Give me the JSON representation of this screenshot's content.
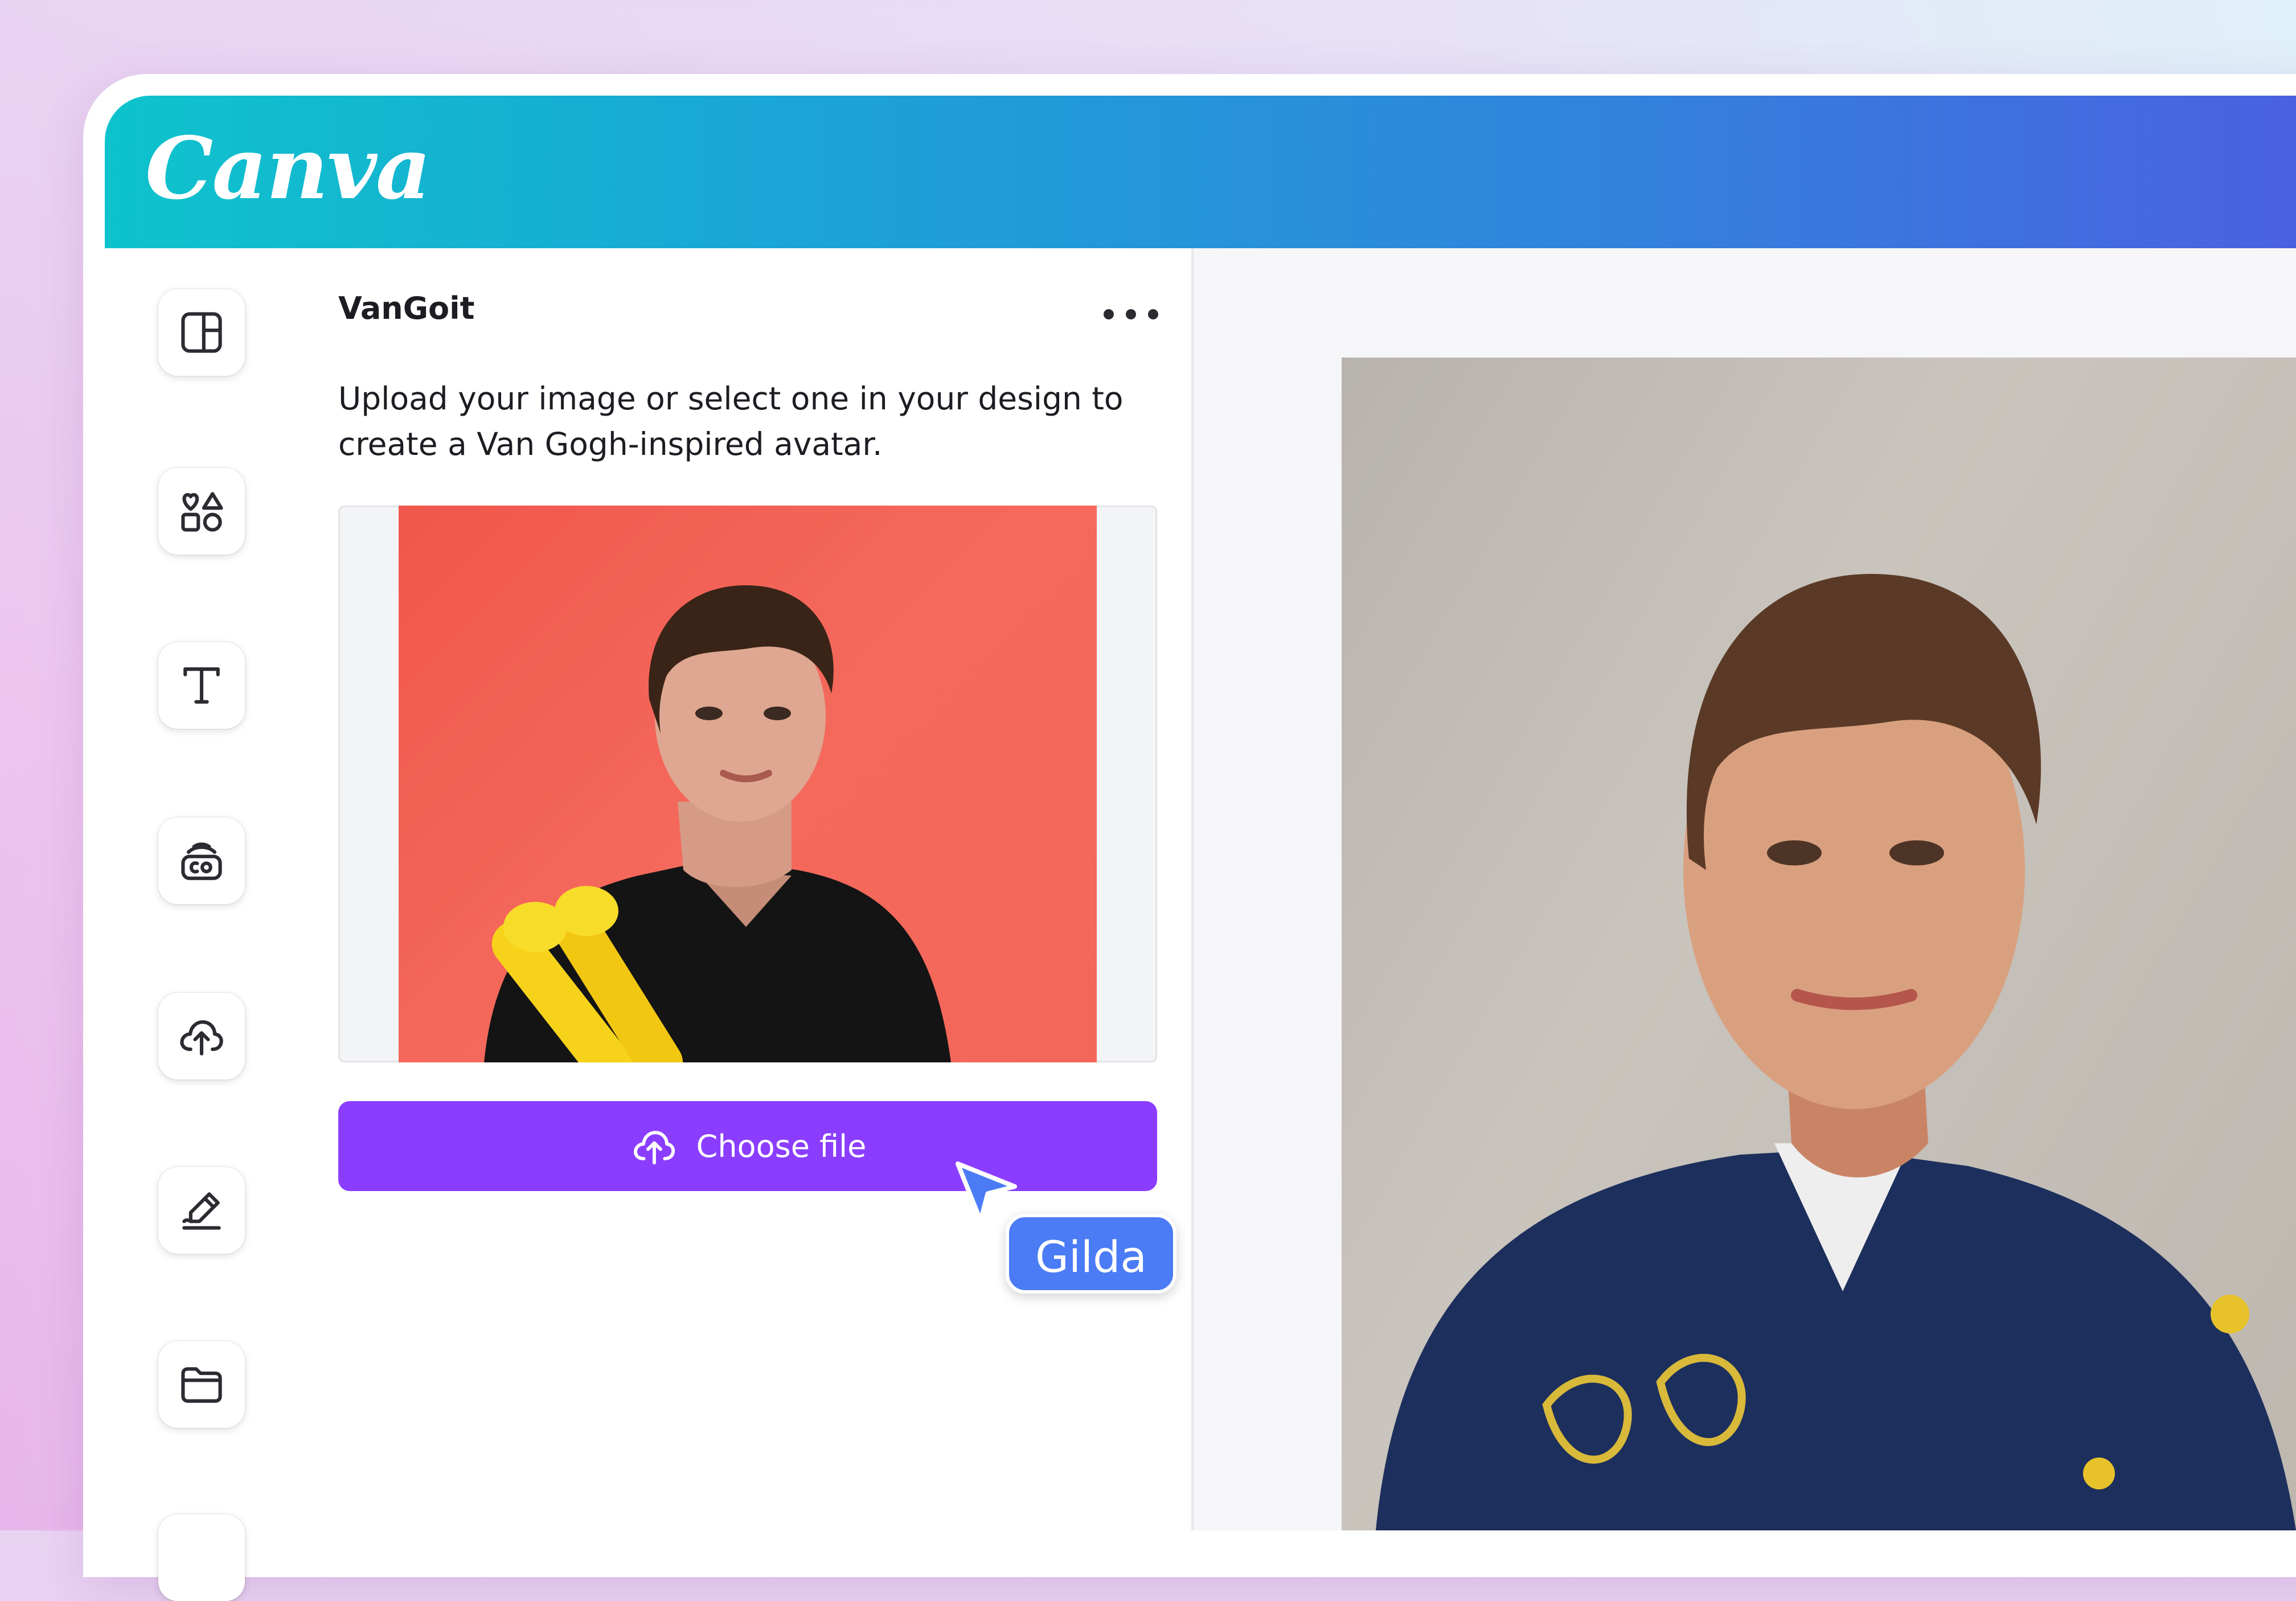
{
  "brand": {
    "logo_text": "Canva"
  },
  "sidebar": {
    "items": [
      {
        "icon": "layout-icon"
      },
      {
        "icon": "elements-icon"
      },
      {
        "icon": "text-icon"
      },
      {
        "icon": "brand-icon"
      },
      {
        "icon": "upload-icon"
      },
      {
        "icon": "draw-icon"
      },
      {
        "icon": "folder-icon"
      }
    ]
  },
  "app_panel": {
    "title": "VanGoit",
    "description": "Upload your image or select one in your design to create a Van Gogh-inspired avatar.",
    "choose_file_label": "Choose file"
  },
  "collaborator": {
    "name": "Gilda"
  },
  "colors": {
    "accent": "#8b3dff",
    "collaborator": "#4b7cf5",
    "header_start": "#0ec3cc",
    "header_end": "#4a62e0"
  }
}
